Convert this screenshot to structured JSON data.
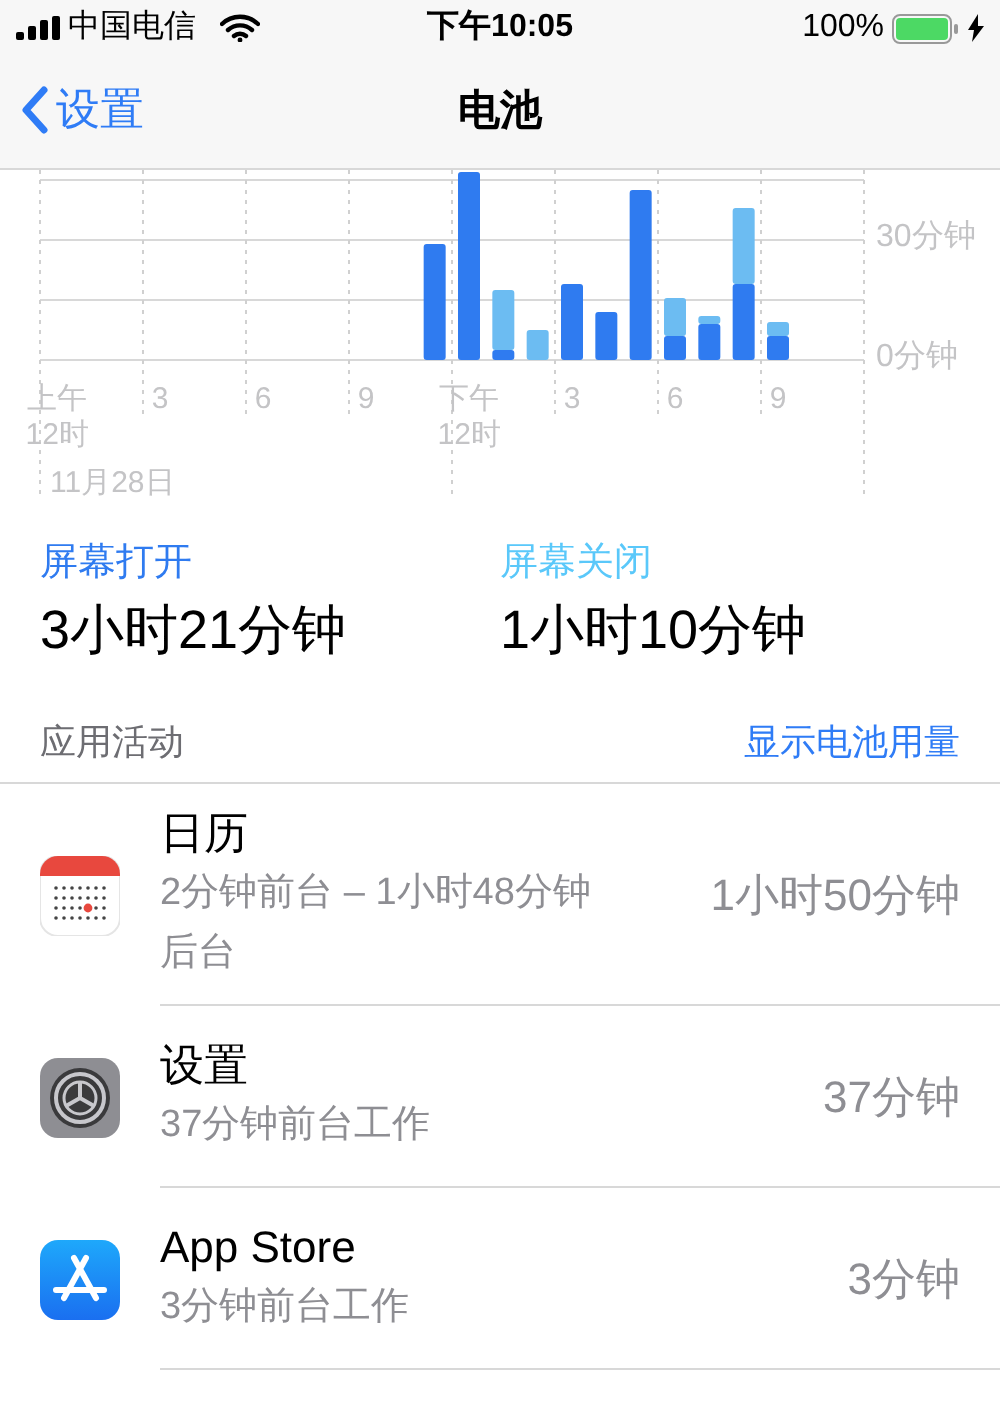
{
  "status_bar": {
    "carrier": "中国电信",
    "time": "下午10:05",
    "battery": "100%"
  },
  "nav": {
    "back": "设置",
    "title": "电池"
  },
  "chart_data": {
    "type": "bar",
    "stacked": true,
    "categories": [
      "上午12时",
      null,
      null,
      "3",
      null,
      null,
      "6",
      null,
      null,
      "9",
      null,
      null,
      "下午12时",
      null,
      null,
      "3",
      null,
      null,
      "6",
      null,
      null,
      "9",
      null,
      null
    ],
    "ylim": [
      0,
      47
    ],
    "yticks": [
      {
        "value": 0,
        "label": "0分钟"
      },
      {
        "value": 30,
        "label": "30分钟"
      }
    ],
    "xlabel": "11月28日",
    "series": [
      {
        "name": "屏幕打开",
        "color": "#2f7bf0",
        "values": [
          null,
          null,
          null,
          null,
          null,
          null,
          null,
          null,
          null,
          null,
          null,
          29,
          47,
          2.5,
          0,
          19,
          12,
          42.5,
          6,
          9,
          19,
          6,
          null,
          null
        ]
      },
      {
        "name": "屏幕关闭",
        "color": "#6cbcf2",
        "values": [
          null,
          null,
          null,
          null,
          null,
          null,
          null,
          null,
          null,
          null,
          null,
          0,
          0,
          15,
          7.5,
          0,
          0,
          0,
          9.5,
          2,
          19,
          3.5,
          null,
          null
        ]
      }
    ]
  },
  "summary": [
    {
      "value": "3小时21分钟",
      "color": "#2f7bf0"
    },
    {
      "value": "1小时10分钟",
      "color": "#5ac8fa"
    }
  ],
  "section": {
    "title": "应用活动",
    "action": "显示电池用量"
  },
  "apps": [
    {
      "kind": "calendar",
      "name": "日历",
      "detail": "2分钟前台 – 1小时48分钟后台",
      "usage": "1小时50分钟"
    },
    {
      "kind": "settings",
      "name": "设置",
      "detail": "37分钟前台工作",
      "usage": "37分钟"
    },
    {
      "kind": "appstore",
      "name": "App Store",
      "detail": "3分钟前台工作",
      "usage": "3分钟"
    }
  ]
}
